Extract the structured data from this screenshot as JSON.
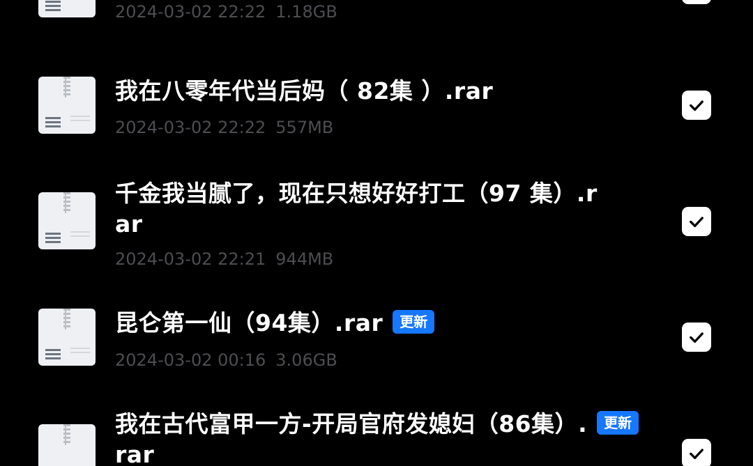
{
  "files": [
    {
      "name_lines": [
        "",
        ""
      ],
      "badge": "",
      "date": "2024-03-02 22:22",
      "size": "1.18GB",
      "checked": true,
      "icon": "archive-file-icon"
    },
    {
      "name_lines": [
        "我在八零年代当后妈（ 82集 ）.rar",
        ""
      ],
      "badge": "",
      "date": "2024-03-02 22:22",
      "size": "557MB",
      "checked": true,
      "icon": "archive-file-icon"
    },
    {
      "name_lines": [
        "千金我当腻了，现在只想好好打工（97 集）.r",
        "ar"
      ],
      "badge": "",
      "date": "2024-03-02 22:21",
      "size": "944MB",
      "checked": true,
      "icon": "archive-file-icon"
    },
    {
      "name_lines": [
        "昆仑第一仙（94集）.rar",
        ""
      ],
      "badge": "更新",
      "date": "2024-03-02 00:16",
      "size": "3.06GB",
      "checked": true,
      "icon": "archive-file-icon"
    },
    {
      "name_lines": [
        "我在古代富甲一方-开局官府发媳妇（86集）.",
        "rar"
      ],
      "badge": "更新",
      "date": "",
      "size": "",
      "checked": true,
      "icon": "archive-file-icon"
    }
  ],
  "icons": {
    "checkmark": "checkmark-icon"
  },
  "colors": {
    "background": "#000000",
    "badge": "#1677ff",
    "meta_text": "#4d4d52",
    "name_text": "#ffffff"
  }
}
